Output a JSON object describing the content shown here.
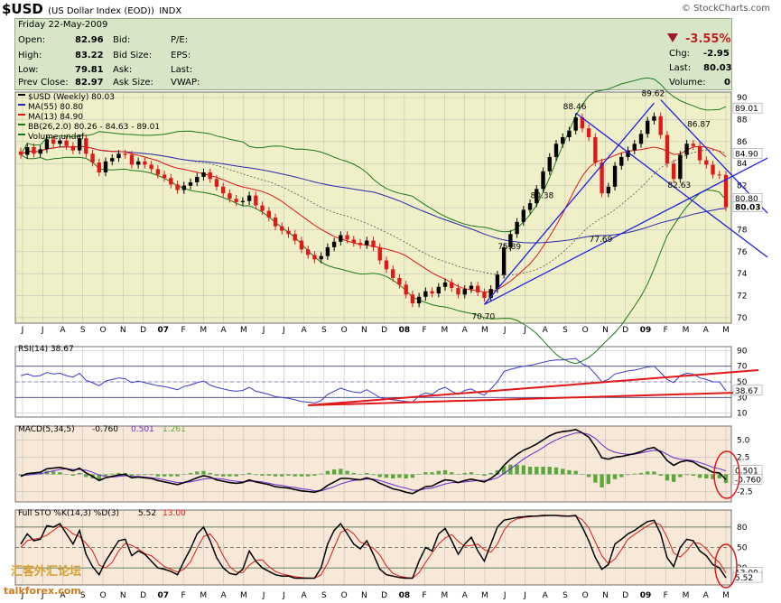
{
  "header": {
    "symbol": "$USD",
    "description": "(US Dollar Index (EOD))",
    "exchange": "INDX",
    "watermark": "© StockCharts.com"
  },
  "quote": {
    "date": "Friday 22-May-2009",
    "open_label": "Open:",
    "open": "82.96",
    "high_label": "High:",
    "high": "83.22",
    "low_label": "Low:",
    "low": "79.81",
    "prev_close_label": "Prev Close:",
    "prev_close": "82.97",
    "bid_label": "Bid:",
    "bid_size_label": "Bid Size:",
    "ask_label": "Ask:",
    "ask_size_label": "Ask Size:",
    "pe_label": "P/E:",
    "eps_label": "EPS:",
    "last_label": "Last:",
    "vwap_label": "VWAP:",
    "change_pct": "-3.55%",
    "chg_label": "Chg:",
    "chg": "-2.95",
    "last2_label": "Last:",
    "last": "80.03",
    "volume_label": "Volume:",
    "volume": "0"
  },
  "colors": {
    "up": "#000000",
    "down": "#e01818",
    "bb": "#1a7a1a",
    "ma55": "#2828b0",
    "ma13": "#e01818",
    "panel_bg": "#f0f0c8",
    "grid": "#b8b8b8",
    "panel_alt": "#f8e8d8"
  },
  "legend": {
    "price": "$USD (Weekly) 80.03",
    "ma55": "MA(55) 80.80",
    "ma13": "MA(13) 84.90",
    "bb": "BB(26,2.0) 80.26 - 84.63 - 89.01",
    "vol": "Volume undef"
  },
  "chart_data": [
    {
      "type": "candlestick",
      "title": "$USD (Weekly) 80.03",
      "x_ticks": [
        "J",
        "J",
        "A",
        "S",
        "O",
        "N",
        "D",
        "07",
        "F",
        "M",
        "A",
        "M",
        "J",
        "J",
        "A",
        "S",
        "O",
        "N",
        "D",
        "08",
        "F",
        "M",
        "A",
        "M",
        "J",
        "J",
        "A",
        "S",
        "O",
        "N",
        "D",
        "09",
        "F",
        "M",
        "A",
        "M"
      ],
      "y_ticks": [
        70,
        72,
        74,
        76,
        78,
        80,
        82,
        84,
        86,
        88,
        90
      ],
      "ylim": [
        69.5,
        90.5
      ],
      "close": [
        84.8,
        85.5,
        84.9,
        85.3,
        86.2,
        85.8,
        86.1,
        85.6,
        85.2,
        86.3,
        84.9,
        84.1,
        83.2,
        84.2,
        84.5,
        84.9,
        84.8,
        83.9,
        84.2,
        83.9,
        83.5,
        83.0,
        82.7,
        82.1,
        81.6,
        82.0,
        82.3,
        82.8,
        83.2,
        82.6,
        81.9,
        81.3,
        80.8,
        80.5,
        80.6,
        81.1,
        80.2,
        79.7,
        79.1,
        78.3,
        77.9,
        77.6,
        77.0,
        76.2,
        75.7,
        75.3,
        75.6,
        76.4,
        76.9,
        77.5,
        77.1,
        76.8,
        76.6,
        77.0,
        76.4,
        75.2,
        74.4,
        73.6,
        73.0,
        72.1,
        71.3,
        71.9,
        72.4,
        72.2,
        72.8,
        73.2,
        72.7,
        72.1,
        72.6,
        72.9,
        72.3,
        71.8,
        72.6,
        73.9,
        76.4,
        77.6,
        78.7,
        79.8,
        80.4,
        81.7,
        83.3,
        84.6,
        85.8,
        86.4,
        87.0,
        88.2,
        87.2,
        86.4,
        84.1,
        81.3,
        81.9,
        83.8,
        84.6,
        85.2,
        85.8,
        86.7,
        87.9,
        88.3,
        86.6,
        84.0,
        82.6,
        84.8,
        85.8,
        85.6,
        84.3,
        83.9,
        83.0,
        82.97,
        80.03
      ],
      "annotations": [
        {
          "text": "70.70",
          "value": 70.7
        },
        {
          "text": "75.89",
          "value": 75.89
        },
        {
          "text": "80.38",
          "value": 80.38
        },
        {
          "text": "88.46",
          "value": 88.46
        },
        {
          "text": "77.69",
          "value": 77.69
        },
        {
          "text": "89.62",
          "value": 89.62
        },
        {
          "text": "82.63",
          "value": 82.63
        },
        {
          "text": "86.87",
          "value": 86.87
        }
      ],
      "right_labels": [
        {
          "text": "89.01",
          "value": 89.01
        },
        {
          "text": "84.90",
          "value": 84.9
        },
        {
          "text": "80.80",
          "value": 80.8
        },
        {
          "text": "80.03",
          "value": 80.03
        }
      ]
    },
    {
      "type": "line",
      "title": "RSI(14) 38.67",
      "y_ticks": [
        10,
        30,
        50,
        70,
        90
      ],
      "ylim": [
        5,
        95
      ],
      "values": [
        58,
        60,
        57,
        58,
        62,
        60,
        61,
        58,
        56,
        61,
        52,
        49,
        45,
        51,
        53,
        55,
        54,
        49,
        51,
        49,
        47,
        45,
        44,
        42,
        40,
        44,
        46,
        49,
        51,
        46,
        43,
        41,
        39,
        38,
        39,
        43,
        38,
        36,
        34,
        31,
        30,
        29,
        27,
        25,
        24,
        23,
        26,
        34,
        38,
        42,
        39,
        37,
        36,
        40,
        35,
        30,
        28,
        27,
        26,
        25,
        24,
        32,
        36,
        34,
        40,
        43,
        38,
        34,
        39,
        41,
        36,
        33,
        41,
        50,
        63,
        66,
        68,
        70,
        71,
        73,
        75,
        77,
        78,
        78,
        79,
        80,
        73,
        69,
        60,
        50,
        53,
        60,
        62,
        64,
        65,
        67,
        69,
        70,
        62,
        53,
        49,
        58,
        61,
        60,
        55,
        53,
        50,
        50,
        38.67
      ],
      "right_labels": [
        {
          "text": "38.67",
          "value": 38.67
        }
      ]
    },
    {
      "type": "line",
      "title": "MACD(5,34,5) -0.760, 0.501, 1.261",
      "series_labels": [
        "-0.760",
        "0.501",
        "1.261"
      ],
      "y_ticks": [
        "5.0",
        "2.5",
        "0.0",
        "-2.5"
      ],
      "y_tick_values": [
        5,
        2.5,
        0,
        -2.5
      ],
      "ylim": [
        -4,
        7
      ],
      "macd": [
        -0.3,
        0.1,
        0.2,
        0.3,
        0.8,
        0.9,
        1.0,
        0.8,
        0.5,
        0.9,
        0.2,
        -0.3,
        -0.9,
        -0.5,
        -0.3,
        -0.1,
        0.0,
        -0.5,
        -0.4,
        -0.5,
        -0.6,
        -0.9,
        -1.1,
        -1.3,
        -1.5,
        -1.2,
        -0.9,
        -0.5,
        -0.2,
        -0.4,
        -0.8,
        -1.0,
        -1.2,
        -1.3,
        -1.2,
        -0.8,
        -1.1,
        -1.3,
        -1.5,
        -1.8,
        -1.9,
        -2.0,
        -2.2,
        -2.4,
        -2.5,
        -2.6,
        -2.3,
        -1.6,
        -1.1,
        -0.6,
        -0.6,
        -0.7,
        -0.8,
        -0.5,
        -0.8,
        -1.3,
        -1.7,
        -2.1,
        -2.3,
        -2.6,
        -2.8,
        -2.3,
        -1.8,
        -1.7,
        -1.2,
        -0.8,
        -0.9,
        -1.2,
        -0.9,
        -0.7,
        -0.9,
        -1.1,
        -0.6,
        0.1,
        1.3,
        2.2,
        2.9,
        3.5,
        3.9,
        4.4,
        5.0,
        5.6,
        6.0,
        6.2,
        6.3,
        6.5,
        6.0,
        5.4,
        4.0,
        2.4,
        2.2,
        2.5,
        2.6,
        2.8,
        3.0,
        3.3,
        3.7,
        3.9,
        3.2,
        2.0,
        1.3,
        1.8,
        2.0,
        1.8,
        1.2,
        0.8,
        0.3,
        0.2,
        -0.76
      ],
      "signal": [
        -0.1,
        -0.1,
        0.0,
        0.1,
        0.3,
        0.5,
        0.7,
        0.8,
        0.7,
        0.7,
        0.6,
        0.3,
        -0.1,
        -0.3,
        -0.4,
        -0.3,
        -0.2,
        -0.3,
        -0.3,
        -0.4,
        -0.5,
        -0.6,
        -0.8,
        -1.0,
        -1.2,
        -1.2,
        -1.1,
        -0.9,
        -0.7,
        -0.6,
        -0.6,
        -0.7,
        -0.9,
        -1.0,
        -1.1,
        -1.0,
        -1.0,
        -1.1,
        -1.3,
        -1.5,
        -1.6,
        -1.8,
        -1.9,
        -2.1,
        -2.2,
        -2.4,
        -2.4,
        -2.1,
        -1.8,
        -1.4,
        -1.1,
        -0.9,
        -0.8,
        -0.7,
        -0.7,
        -0.9,
        -1.2,
        -1.5,
        -1.8,
        -2.0,
        -2.3,
        -2.3,
        -2.1,
        -2.0,
        -1.7,
        -1.4,
        -1.2,
        -1.2,
        -1.1,
        -1.0,
        -0.9,
        -0.9,
        -0.8,
        -0.5,
        0.1,
        0.8,
        1.5,
        2.2,
        2.8,
        3.3,
        3.9,
        4.5,
        5.0,
        5.4,
        5.7,
        6.0,
        6.0,
        5.8,
        5.2,
        4.3,
        3.6,
        3.2,
        3.0,
        2.9,
        2.9,
        3.1,
        3.3,
        3.5,
        3.4,
        2.9,
        2.4,
        2.2,
        2.1,
        2.0,
        1.7,
        1.4,
        1.0,
        0.8,
        0.501
      ],
      "right_labels": [
        {
          "text": "0.501",
          "value": 0.501
        },
        {
          "text": "-0.760",
          "value": -0.76
        }
      ]
    },
    {
      "type": "line",
      "title": "Full STO %K(14,3) %D(3) 5.52, 13.00",
      "series_labels": [
        "5.52",
        "13.00"
      ],
      "y_ticks": [
        20,
        50,
        80
      ],
      "ylim": [
        -5,
        105
      ],
      "k": [
        55,
        70,
        60,
        62,
        82,
        80,
        85,
        70,
        55,
        75,
        40,
        22,
        10,
        30,
        45,
        60,
        62,
        38,
        45,
        40,
        30,
        20,
        18,
        15,
        10,
        30,
        48,
        70,
        80,
        60,
        35,
        20,
        12,
        10,
        18,
        45,
        30,
        20,
        15,
        10,
        8,
        8,
        5,
        5,
        5,
        5,
        20,
        55,
        75,
        85,
        70,
        55,
        48,
        60,
        40,
        18,
        10,
        8,
        6,
        5,
        5,
        30,
        50,
        45,
        70,
        78,
        60,
        40,
        55,
        65,
        45,
        30,
        55,
        80,
        90,
        92,
        94,
        95,
        96,
        96,
        97,
        97,
        97,
        96,
        96,
        97,
        80,
        60,
        35,
        18,
        25,
        55,
        62,
        70,
        75,
        82,
        88,
        90,
        70,
        35,
        22,
        50,
        62,
        60,
        45,
        38,
        25,
        20,
        5.52
      ],
      "d": [
        50,
        60,
        62,
        64,
        68,
        75,
        82,
        78,
        70,
        66,
        56,
        45,
        24,
        20,
        28,
        45,
        56,
        53,
        48,
        41,
        38,
        30,
        22,
        18,
        14,
        18,
        29,
        49,
        66,
        70,
        58,
        38,
        22,
        14,
        13,
        24,
        31,
        32,
        22,
        15,
        11,
        9,
        7,
        6,
        5,
        5,
        10,
        27,
        50,
        72,
        77,
        70,
        58,
        54,
        49,
        39,
        23,
        12,
        8,
        6,
        5,
        13,
        28,
        42,
        55,
        64,
        69,
        59,
        52,
        53,
        55,
        47,
        43,
        55,
        75,
        87,
        92,
        94,
        95,
        96,
        96,
        97,
        97,
        97,
        96,
        96,
        91,
        79,
        58,
        38,
        26,
        33,
        47,
        62,
        69,
        76,
        82,
        87,
        83,
        65,
        42,
        36,
        45,
        57,
        56,
        48,
        36,
        28,
        13.0
      ],
      "right_labels": [
        {
          "text": "13.00",
          "value": 13.0
        },
        {
          "text": "5.52",
          "value": 5.52
        }
      ]
    }
  ]
}
